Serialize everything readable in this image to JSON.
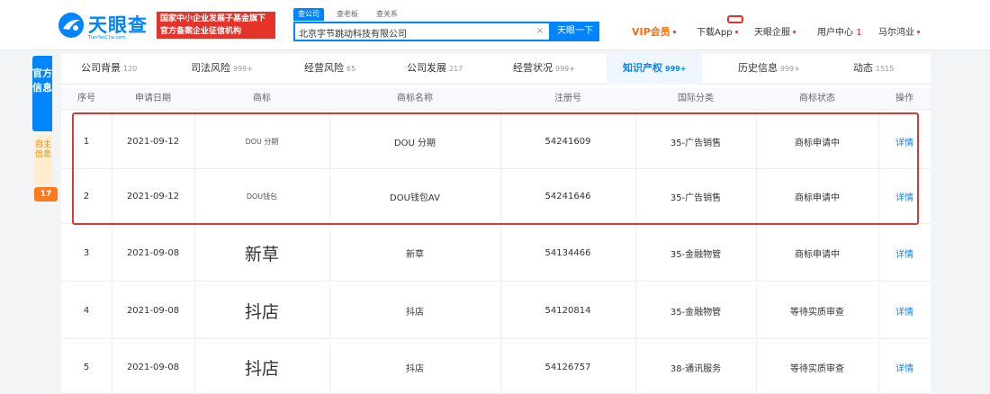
{
  "header": {
    "logo_text": "天眼查",
    "logo_sub": "TianYanCha.com",
    "banner_line1": "国家中小企业发展子基金旗下",
    "banner_line2": "官方备案企业征信机构",
    "search_tabs": [
      "查公司",
      "查老板",
      "查关系"
    ],
    "search_value": "北京字节跳动科技有限公司",
    "search_clear": "×",
    "search_button": "天眼一下",
    "nav": {
      "vip": "VIP会员",
      "app": "下载App",
      "service": "天眼企服",
      "user_center": "用户中心",
      "user_center_num": "1",
      "user_name": "马尔鸿业"
    }
  },
  "sidebar": {
    "official": "官方信息",
    "self_info": "自主信息",
    "self_count": "17"
  },
  "tabs": [
    {
      "label": "公司背景",
      "count": "120"
    },
    {
      "label": "司法风险",
      "count": "999+"
    },
    {
      "label": "经营风险",
      "count": "65"
    },
    {
      "label": "公司发展",
      "count": "217"
    },
    {
      "label": "经营状况",
      "count": "999+"
    },
    {
      "label": "知识产权",
      "count": "999+"
    },
    {
      "label": "历史信息",
      "count": "999+"
    },
    {
      "label": "动态",
      "count": "1515"
    }
  ],
  "table": {
    "headers": [
      "序号",
      "申请日期",
      "商标",
      "商标名称",
      "注册号",
      "国际分类",
      "商标状态",
      "操作"
    ],
    "rows": [
      {
        "index": "1",
        "date": "2021-09-12",
        "logo": "DOU 分期",
        "name": "DOU 分期",
        "reg_no": "54241609",
        "category": "35-广告销售",
        "status": "商标申请中",
        "action": "详情"
      },
      {
        "index": "2",
        "date": "2021-09-12",
        "logo": "DOU钱包",
        "name": "DOU钱包AV",
        "reg_no": "54241646",
        "category": "35-广告销售",
        "status": "商标申请中",
        "action": "详情"
      },
      {
        "index": "3",
        "date": "2021-09-08",
        "logo": "新草",
        "name": "新草",
        "reg_no": "54134466",
        "category": "35-金融物管",
        "status": "商标申请中",
        "action": "详情"
      },
      {
        "index": "4",
        "date": "2021-09-08",
        "logo": "抖店",
        "name": "抖店",
        "reg_no": "54120814",
        "category": "35-金融物管",
        "status": "等待实质审查",
        "action": "详情"
      },
      {
        "index": "5",
        "date": "2021-09-08",
        "logo": "抖店",
        "name": "抖店",
        "reg_no": "54126757",
        "category": "38-通讯服务",
        "status": "等待实质审查",
        "action": "详情"
      }
    ]
  },
  "colors": {
    "brand": "#0084ff",
    "vip": "#ff6a00",
    "highlight": "#d63a35"
  }
}
